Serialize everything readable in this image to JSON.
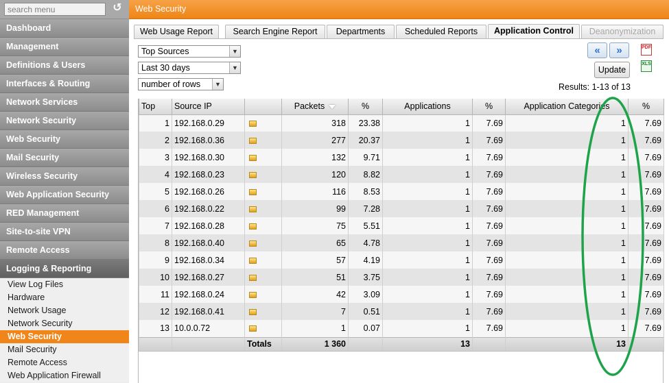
{
  "sidebar": {
    "search_placeholder": "search menu",
    "reset_icon": "refresh-icon",
    "items": [
      {
        "label": "Dashboard"
      },
      {
        "label": "Management"
      },
      {
        "label": "Definitions & Users"
      },
      {
        "label": "Interfaces & Routing"
      },
      {
        "label": "Network Services"
      },
      {
        "label": "Network Security"
      },
      {
        "label": "Web Security"
      },
      {
        "label": "Mail Security"
      },
      {
        "label": "Wireless Security"
      },
      {
        "label": "Web Application Security"
      },
      {
        "label": "RED Management"
      },
      {
        "label": "Site-to-site VPN"
      },
      {
        "label": "Remote Access"
      },
      {
        "label": "Logging & Reporting"
      }
    ],
    "sub_items": [
      {
        "label": "View Log Files"
      },
      {
        "label": "Hardware"
      },
      {
        "label": "Network Usage"
      },
      {
        "label": "Network Security"
      },
      {
        "label": "Web Security",
        "active": true
      },
      {
        "label": "Mail Security"
      },
      {
        "label": "Remote Access"
      },
      {
        "label": "Web Application Firewall"
      }
    ]
  },
  "header": {
    "title": "Web Security"
  },
  "tabs": [
    {
      "label": "Web Usage Report"
    },
    {
      "label": "Search Engine Report"
    },
    {
      "label": "Departments"
    },
    {
      "label": "Scheduled Reports"
    },
    {
      "label": "Application Control",
      "active": true
    },
    {
      "label": "Deanonymization",
      "disabled": true
    }
  ],
  "filters": {
    "view": "Top Sources",
    "period": "Last 30 days",
    "rows": "number of rows"
  },
  "actions": {
    "prev_icon": "double-chevron-left-icon",
    "next_icon": "double-chevron-right-icon",
    "update_label": "Update",
    "pdf_label": "PDF",
    "xls_label": "XLS"
  },
  "results_text": "Results: 1-13 of 13",
  "table": {
    "headers": [
      "Top",
      "Source IP",
      "",
      "Packets",
      "%",
      "Applications",
      "%",
      "Application Categories",
      "%"
    ],
    "rows": [
      [
        "1",
        "192.168.0.29",
        "318",
        "23.38",
        "1",
        "7.69",
        "1",
        "7.69"
      ],
      [
        "2",
        "192.168.0.36",
        "277",
        "20.37",
        "1",
        "7.69",
        "1",
        "7.69"
      ],
      [
        "3",
        "192.168.0.30",
        "132",
        "9.71",
        "1",
        "7.69",
        "1",
        "7.69"
      ],
      [
        "4",
        "192.168.0.23",
        "120",
        "8.82",
        "1",
        "7.69",
        "1",
        "7.69"
      ],
      [
        "5",
        "192.168.0.26",
        "116",
        "8.53",
        "1",
        "7.69",
        "1",
        "7.69"
      ],
      [
        "6",
        "192.168.0.22",
        "99",
        "7.28",
        "1",
        "7.69",
        "1",
        "7.69"
      ],
      [
        "7",
        "192.168.0.28",
        "75",
        "5.51",
        "1",
        "7.69",
        "1",
        "7.69"
      ],
      [
        "8",
        "192.168.0.40",
        "65",
        "4.78",
        "1",
        "7.69",
        "1",
        "7.69"
      ],
      [
        "9",
        "192.168.0.34",
        "57",
        "4.19",
        "1",
        "7.69",
        "1",
        "7.69"
      ],
      [
        "10",
        "192.168.0.27",
        "51",
        "3.75",
        "1",
        "7.69",
        "1",
        "7.69"
      ],
      [
        "11",
        "192.168.0.24",
        "42",
        "3.09",
        "1",
        "7.69",
        "1",
        "7.69"
      ],
      [
        "12",
        "192.168.0.41",
        "7",
        "0.51",
        "1",
        "7.69",
        "1",
        "7.69"
      ],
      [
        "13",
        "10.0.0.72",
        "1",
        "0.07",
        "1",
        "7.69",
        "1",
        "7.69"
      ]
    ],
    "totals": {
      "label": "Totals",
      "packets": "1 360",
      "applications": "13",
      "categories": "13"
    }
  },
  "colors": {
    "accent": "#ee8516",
    "annotation": "#1fa34a"
  }
}
